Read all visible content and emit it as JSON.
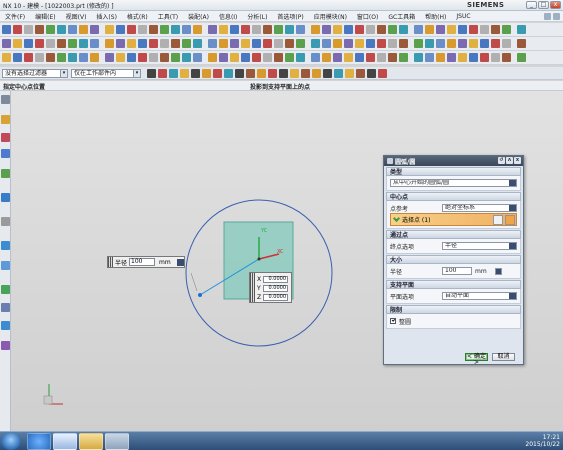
{
  "window": {
    "title": "NX 10 - 建模 - [1022003.prt (修改的) ]",
    "brand": "SIEMENS",
    "min_label": "_",
    "max_label": "□",
    "close_label": "x"
  },
  "menubar": {
    "items": [
      "文件(F)",
      "编辑(E)",
      "视图(V)",
      "插入(S)",
      "格式(R)",
      "工具(T)",
      "装配(A)",
      "信息(I)",
      "分析(L)",
      "首选项(P)",
      "应用模块(N)",
      "窗口(O)",
      "GC工具箱",
      "帮助(H)",
      "JSUC"
    ]
  },
  "selection_bar": {
    "filter": "没有选择过滤器",
    "scope": "仅在工作部件内"
  },
  "cue_line": {
    "left": "指定中心点位置",
    "middle": "投影到支持平面上的点"
  },
  "radius_popup": {
    "label": "半径",
    "value": "100",
    "unit": "mm"
  },
  "xyz_popup": {
    "x_label": "X",
    "x_value": "0.0000",
    "y_label": "Y",
    "y_value": "0.0000",
    "z_label": "Z",
    "z_value": "0.0000"
  },
  "triad": {
    "xc": "XC",
    "yc": "YC"
  },
  "dialog": {
    "title": "圆弧/圆",
    "title_buttons": [
      "↺",
      "ʌ",
      "x"
    ],
    "type_header": "类型",
    "type_value": "从中心开始的圆弧/圆",
    "center_header": "中心点",
    "point_ref_label": "点参考",
    "point_ref_value": "绝对坐标系",
    "select_point": "选择点 (1)",
    "end_header": "通过点",
    "end_option_label": "终点选项",
    "end_option_value": "半径",
    "size_header": "大小",
    "radius_label": "半径",
    "radius_value": "100",
    "radius_unit": "mm",
    "plane_header": "支持平面",
    "plane_option_label": "平面选项",
    "plane_option_value": "自动平面",
    "limits_header": "限制",
    "full_circle_label": "整圆",
    "ok": "< 确定 >",
    "cancel": "取消"
  },
  "taskbar": {
    "time": "17:21",
    "date": "2015/10/22"
  },
  "colors": {
    "circle": "#3a5fb0",
    "plane_fill": "#8ccbbe",
    "dialog_title": "#3b4859",
    "select_highlight": "#f1b062"
  }
}
